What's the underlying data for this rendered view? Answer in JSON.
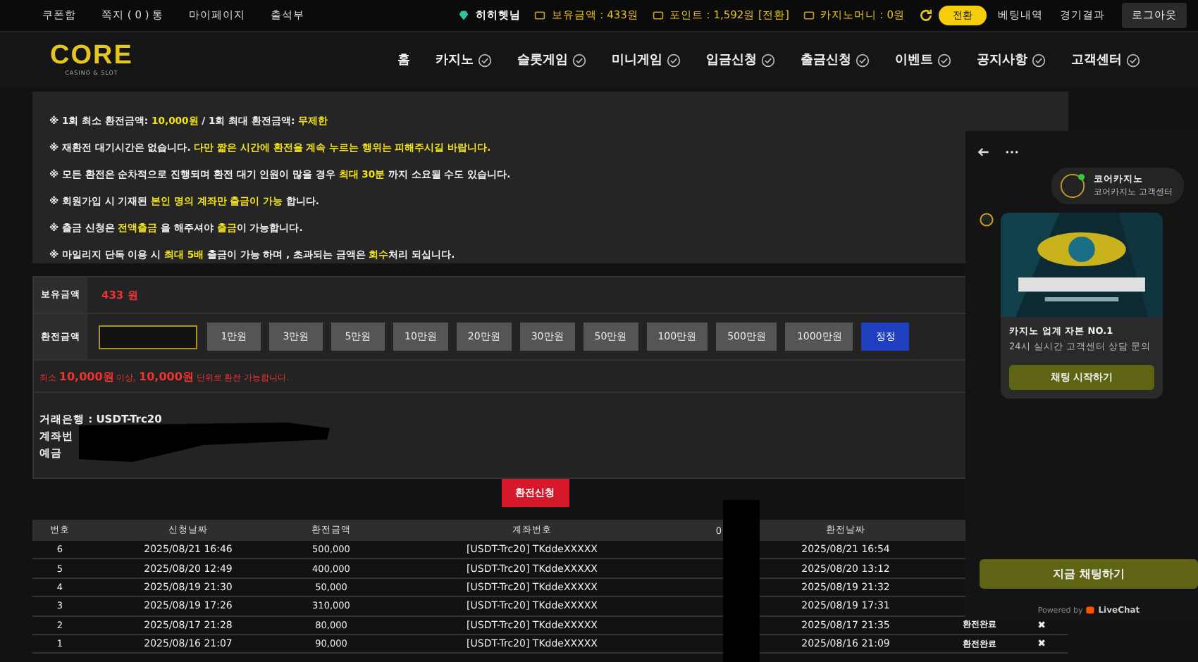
{
  "top_links": [
    "쿠폰함",
    "쪽지 ( 0 ) 통",
    "마이페이지",
    "출석부"
  ],
  "user": {
    "name": "히히헷님",
    "balance": "보유금액 : 433원",
    "points": "포인트 : 1,592원 [전환]",
    "casino_money": "카지노머니 : 0원",
    "convert_button": "전환",
    "links": [
      "베팅내역",
      "경기결과"
    ],
    "logout": "로그아웃"
  },
  "logo": {
    "title": "CORE",
    "subtitle": "CASINO & SLOT"
  },
  "nav": [
    {
      "label": "홈",
      "icon": false
    },
    {
      "label": "카지노",
      "icon": true
    },
    {
      "label": "슬롯게임",
      "icon": true
    },
    {
      "label": "미니게임",
      "icon": true
    },
    {
      "label": "입금신청",
      "icon": true
    },
    {
      "label": "출금신청",
      "icon": true
    },
    {
      "label": "이벤트",
      "icon": true
    },
    {
      "label": "공지사항",
      "icon": true
    },
    {
      "label": "고객센터",
      "icon": true
    }
  ],
  "notices": [
    "※ 1회 최소 환전금액: **10,000원** / 1회 최대 환전금액: **무제한**",
    "※ 재환전 대기시간은 없습니다. **다만 짧은 시간에 환전을 계속 누르는 행위는 피해주시길 바랍니다.**",
    "※ 모든 환전은 순차적으로 진행되며 환전 대기 인원이 많을 경우 **최대 30분** 까지 소요될 수도 있습니다.",
    "※ 회원가입 시 기재된 **본인 명의 계좌만 출금이 가능** 합니다.",
    "※ 출금 신청은 **전액출금** 을 해주셔야 **출금**이 가능합니다.",
    "※ 마일리지 단독 이용 시 **최대 5배** 출금이 가능 하며 , 초과되는 금액은 **회수**처리 되십니다."
  ],
  "form": {
    "balance_label": "보유금액",
    "balance_value": "433 원",
    "amount_label": "환전금액",
    "amount_buttons": [
      "1만원",
      "3만원",
      "5만원",
      "10만원",
      "20만원",
      "30만원",
      "50만원",
      "100만원",
      "500만원",
      "1000만원"
    ],
    "reset_button": "정정",
    "hint": "최소 **10,000원** 이상, **10,000원** 단위로 환전 가능합니다.",
    "bank_lines": [
      "거래은행 : USDT-Trc20",
      "계좌번",
      "예금"
    ]
  },
  "submit_button": "환전신청",
  "table": {
    "columns": [
      "번호",
      "신청날짜",
      "환전금액",
      "계좌번호",
      "0",
      "환전날짜"
    ],
    "rows": [
      {
        "cells": [
          "6",
          "2025/08/21 16:46",
          "500,000",
          "[USDT-Trc20] TKddeXXXXX",
          "2025/08/21 16:54"
        ]
      },
      {
        "cells": [
          "5",
          "2025/08/20 12:49",
          "400,000",
          "[USDT-Trc20] TKddeXXXXX",
          "2025/08/20 13:12"
        ]
      },
      {
        "cells": [
          "4",
          "2025/08/19 21:30",
          "50,000",
          "[USDT-Trc20] TKddeXXXXX",
          "2025/08/19 21:32"
        ]
      },
      {
        "cells": [
          "3",
          "2025/08/19 17:26",
          "310,000",
          "[USDT-Trc20] TKddeXXXXX",
          "2025/08/19 17:31"
        ]
      },
      {
        "cells": [
          "2",
          "2025/08/17 21:28",
          "80,000",
          "[USDT-Trc20] TKddeXXXXX",
          "2025/08/17 21:35"
        ],
        "status": "환전완료",
        "delete": "✖"
      },
      {
        "cells": [
          "1",
          "2025/08/16 21:07",
          "90,000",
          "[USDT-Trc20] TKddeXXXXX",
          "2025/08/16 21:09"
        ],
        "status": "환전완료",
        "delete": "✖"
      }
    ]
  },
  "chat": {
    "agent_name": "코어카지노",
    "agent_role": "코어카지노 고객센터",
    "message_title": "카지노 업계 자본 NO.1",
    "message_text": "24시 실시간 고객센터 상담 문의",
    "start_button": "채팅 시작하기",
    "chat_now_button": "지금 채팅하기",
    "powered_by": "Powered by",
    "brand": "LiveChat"
  }
}
